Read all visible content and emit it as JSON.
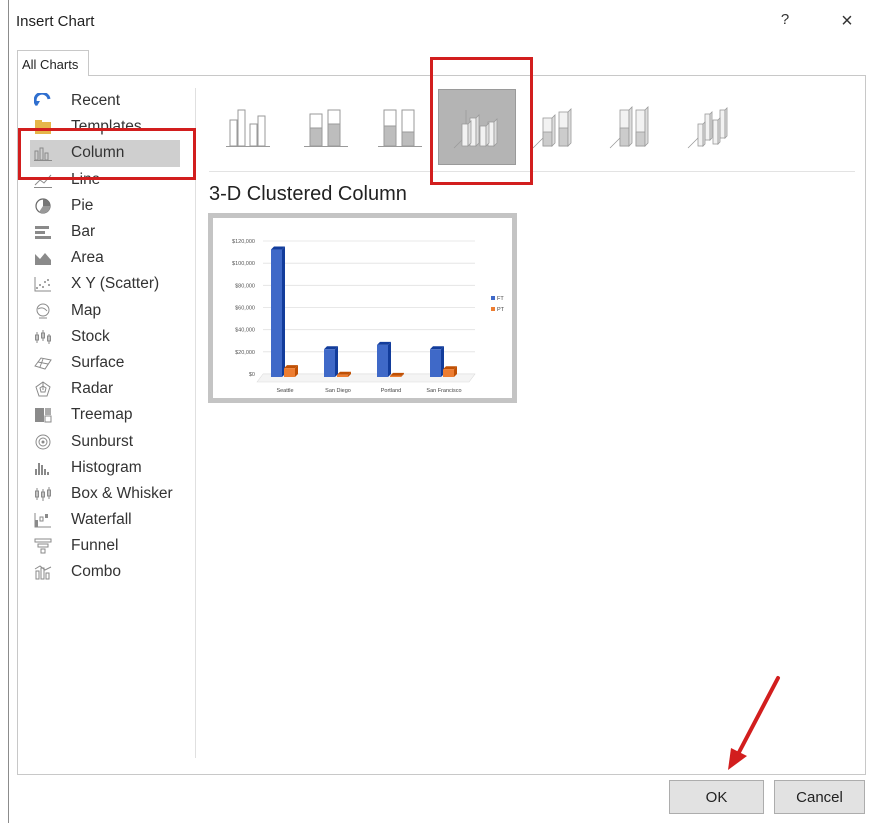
{
  "dialog": {
    "title": "Insert Chart",
    "help_label": "?",
    "close_label": "×"
  },
  "tab": {
    "label": "All Charts"
  },
  "sidebar": {
    "items": [
      {
        "label": "Recent",
        "icon": "recent-icon"
      },
      {
        "label": "Templates",
        "icon": "templates-icon"
      },
      {
        "label": "Column",
        "icon": "column-chart-icon"
      },
      {
        "label": "Line",
        "icon": "line-chart-icon"
      },
      {
        "label": "Pie",
        "icon": "pie-chart-icon"
      },
      {
        "label": "Bar",
        "icon": "bar-chart-icon"
      },
      {
        "label": "Area",
        "icon": "area-chart-icon"
      },
      {
        "label": "X Y (Scatter)",
        "icon": "scatter-chart-icon"
      },
      {
        "label": "Map",
        "icon": "map-chart-icon"
      },
      {
        "label": "Stock",
        "icon": "stock-chart-icon"
      },
      {
        "label": "Surface",
        "icon": "surface-chart-icon"
      },
      {
        "label": "Radar",
        "icon": "radar-chart-icon"
      },
      {
        "label": "Treemap",
        "icon": "treemap-chart-icon"
      },
      {
        "label": "Sunburst",
        "icon": "sunburst-chart-icon"
      },
      {
        "label": "Histogram",
        "icon": "histogram-chart-icon"
      },
      {
        "label": "Box & Whisker",
        "icon": "box-whisker-chart-icon"
      },
      {
        "label": "Waterfall",
        "icon": "waterfall-chart-icon"
      },
      {
        "label": "Funnel",
        "icon": "funnel-chart-icon"
      },
      {
        "label": "Combo",
        "icon": "combo-chart-icon"
      }
    ],
    "selected": "Column"
  },
  "subtypes": {
    "selected_title": "3-D Clustered Column",
    "items": [
      {
        "icon": "clustered-column-icon"
      },
      {
        "icon": "stacked-column-icon"
      },
      {
        "icon": "100-stacked-column-icon"
      },
      {
        "icon": "3d-clustered-column-icon"
      },
      {
        "icon": "3d-stacked-column-icon"
      },
      {
        "icon": "3d-100-stacked-column-icon"
      },
      {
        "icon": "3d-column-icon"
      }
    ],
    "selected_index": 3
  },
  "chart_data": {
    "type": "bar",
    "categories": [
      "Seattle",
      "San Diego",
      "Portland",
      "San Francisco"
    ],
    "series": [
      {
        "name": "FT",
        "values": [
          115000,
          25000,
          29000,
          25000
        ],
        "color": "#3f69c8"
      },
      {
        "name": "PT",
        "values": [
          8000,
          2000,
          1000,
          7000
        ],
        "color": "#ed7d31"
      }
    ],
    "yticks": [
      "$0",
      "$20,000",
      "$40,000",
      "$60,000",
      "$80,000",
      "$100,000",
      "$120,000"
    ],
    "ylim": [
      0,
      120000
    ],
    "legend_position": "right",
    "grid": true
  },
  "footer": {
    "ok_label": "OK",
    "cancel_label": "Cancel"
  },
  "colors": {
    "annotation_red": "#d21e1e",
    "selection_gray": "#cfcfcf"
  }
}
